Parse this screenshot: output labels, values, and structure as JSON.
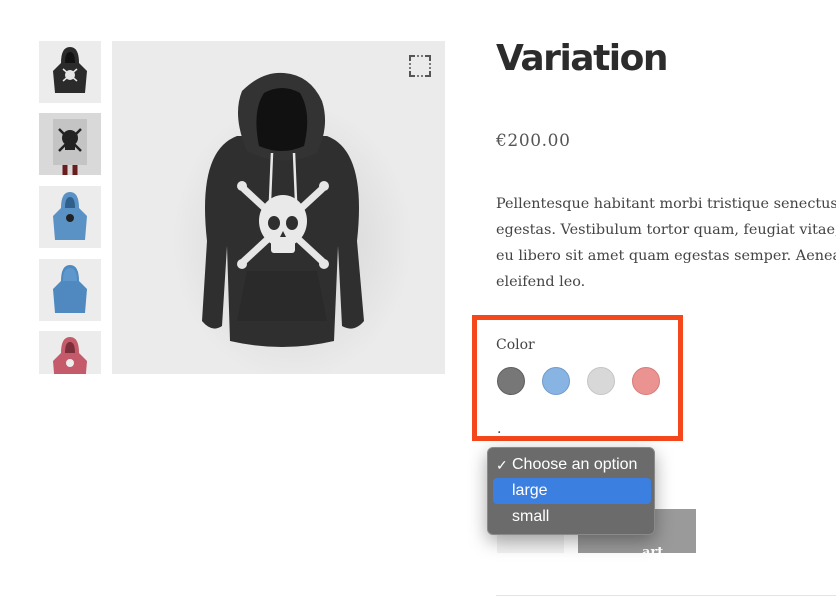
{
  "product": {
    "title": "Variation",
    "price": "€200.00",
    "description_lines": [
      "Pellentesque habitant morbi tristique senectus et net",
      "egestas. Vestibulum tortor quam, feugiat vitae, ultric",
      "eu libero sit amet quam egestas semper. Aenean ultri",
      "eleifend leo."
    ]
  },
  "gallery": {
    "thumbnails": [
      {
        "name": "black-hoodie-skull"
      },
      {
        "name": "skull-poster"
      },
      {
        "name": "blue-hoodie-front"
      },
      {
        "name": "blue-hoodie-back"
      },
      {
        "name": "pink-hoodie"
      }
    ],
    "zoom_icon": "fullscreen-icon"
  },
  "variations": {
    "color_label": "Color",
    "swatches": [
      {
        "name": "dark-gray",
        "color": "#777777"
      },
      {
        "name": "light-blue",
        "color": "#87b4e2"
      },
      {
        "name": "light-gray",
        "color": "#d8d8d8"
      },
      {
        "name": "pink",
        "color": "#ea9391"
      }
    ],
    "size_dropdown": {
      "options": [
        {
          "label": "Choose an option",
          "checked": true
        },
        {
          "label": "large",
          "highlighted": true
        },
        {
          "label": "small"
        }
      ],
      "check_mark": "✓"
    }
  },
  "cart": {
    "button_label": "art"
  },
  "colors": {
    "highlight_border": "#f4471c",
    "dropdown_bg": "#6b6b6b",
    "dropdown_highlight": "#3b7fe0",
    "button_bg": "#9a9a9a"
  }
}
